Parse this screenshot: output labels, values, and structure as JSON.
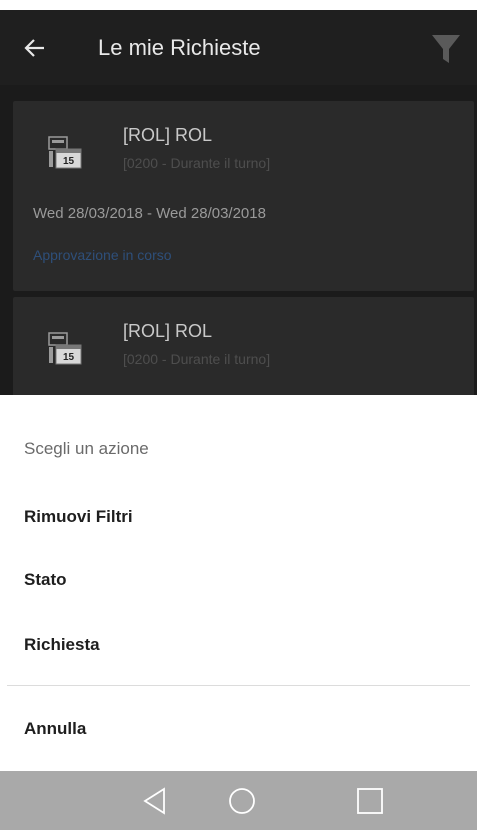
{
  "app_bar": {
    "title": "Le mie Richieste",
    "back_icon": "arrow-left-icon",
    "filter_icon": "filter-funnel-icon"
  },
  "requests": [
    {
      "title": "[ROL] ROL",
      "subtitle": "[0200 - Durante il turno]",
      "dates": "Wed 28/03/2018 - Wed 28/03/2018",
      "status": "Approvazione in corso",
      "icon": "calendar-15-icon"
    },
    {
      "title": "[ROL] ROL",
      "subtitle": "[0200 - Durante il turno]",
      "icon": "calendar-15-icon"
    }
  ],
  "action_sheet": {
    "header": "Scegli un azione",
    "items": [
      "Rimuovi Filtri",
      "Stato",
      "Richiesta"
    ],
    "cancel": "Annulla"
  },
  "calendar_icon_day": "15",
  "nav_bar": {
    "back_icon": "triangle-back-icon",
    "home_icon": "circle-home-icon",
    "recent_icon": "square-recents-icon"
  },
  "colors": {
    "app_bar": "#1f1f1f",
    "card": "#2a2a2a",
    "status_link": "#2e4f7a",
    "sheet": "#ffffff",
    "nav_bar": "#a9a9a9"
  }
}
